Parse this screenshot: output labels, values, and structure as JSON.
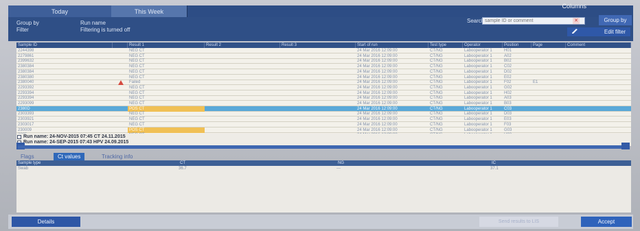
{
  "top": {
    "tabs": [
      "Today",
      "This Week"
    ],
    "right_label": "Columns"
  },
  "filters": {
    "group_by_label": "Group by",
    "run_name_label": "Run name",
    "filter_label": "Filter",
    "filter_value": "Filtering is turned off",
    "search_label": "Search",
    "search_placeholder": "sample ID or comment",
    "group_by_button": "Group by",
    "edit_filter_button": "Edit filter"
  },
  "table": {
    "columns": [
      "Sample ID",
      "",
      "Result 1",
      "Result 2",
      "Result 3",
      "Start of run",
      "Test type",
      "Operator",
      "Position",
      "Page",
      "Comment"
    ],
    "rows": [
      {
        "sample_id": "2244398",
        "result1": "NEG CT",
        "start": "24 Mar 2016 12:09:00",
        "test": "CT/NG",
        "operator": "Labooperator 1",
        "position": "H01",
        "page": "",
        "comment": ""
      },
      {
        "sample_id": "2279861",
        "result1": "NEG CT",
        "start": "24 Mar 2016 12:09:00",
        "test": "CT/NG",
        "operator": "Labooperator 1",
        "position": "A02",
        "page": "",
        "comment": ""
      },
      {
        "sample_id": "2399632",
        "result1": "NEG CT",
        "start": "24 Mar 2016 12:09:00",
        "test": "CT/NG",
        "operator": "Labooperator 1",
        "position": "B02",
        "page": "",
        "comment": ""
      },
      {
        "sample_id": "2380384",
        "result1": "NEG CT",
        "start": "24 Mar 2016 12:09:00",
        "test": "CT/NG",
        "operator": "Labooperator 1",
        "position": "C02",
        "page": "",
        "comment": ""
      },
      {
        "sample_id": "2380384",
        "result1": "NEG CT",
        "start": "24 Mar 2016 12:09:00",
        "test": "CT/NG",
        "operator": "Labooperator 1",
        "position": "D02",
        "page": "",
        "comment": ""
      },
      {
        "sample_id": "2380380",
        "result1": "NEG CT",
        "start": "24 Mar 2016 12:09:00",
        "test": "CT/NG",
        "operator": "Labooperator 1",
        "position": "E02",
        "page": "",
        "comment": ""
      },
      {
        "sample_id": "2380040",
        "result1": "Failed",
        "start": "24 Mar 2016 12:09:00",
        "test": "CT/NG",
        "operator": "Labooperator 1",
        "position": "F02",
        "page": "E1",
        "comment": "",
        "warning": true
      },
      {
        "sample_id": "2293392",
        "result1": "NEG CT",
        "start": "24 Mar 2016 12:09:00",
        "test": "CT/NG",
        "operator": "Labooperator 1",
        "position": "G02",
        "page": "",
        "comment": ""
      },
      {
        "sample_id": "2293394",
        "result1": "NEG CT",
        "start": "24 Mar 2016 12:09:00",
        "test": "CT/NG",
        "operator": "Labooperator 1",
        "position": "H02",
        "page": "",
        "comment": ""
      },
      {
        "sample_id": "2293394",
        "result1": "NEG CT",
        "start": "24 Mar 2016 12:09:00",
        "test": "CT/NG",
        "operator": "Labooperator 1",
        "position": "A03",
        "page": "",
        "comment": ""
      },
      {
        "sample_id": "2293099",
        "result1": "NEG CT",
        "start": "24 Mar 2016 12:09:00",
        "test": "CT/NG",
        "operator": "Labooperator 1",
        "position": "B03",
        "page": "",
        "comment": ""
      },
      {
        "sample_id": "2380D",
        "result1": "POS CT",
        "start": "24 Mar 2016 12:09:00",
        "test": "CT/NG",
        "operator": "Labooperator 1",
        "position": "C03",
        "page": "",
        "comment": "",
        "selected": true,
        "highlight": true
      },
      {
        "sample_id": "2303393",
        "result1": "NEG CT",
        "start": "24 Mar 2016 12:09:00",
        "test": "CT/NG",
        "operator": "Labooperator 1",
        "position": "D03",
        "page": "",
        "comment": ""
      },
      {
        "sample_id": "2303921",
        "result1": "NEG CT",
        "start": "24 Mar 2016 12:09:00",
        "test": "CT/NG",
        "operator": "Labooperator 1",
        "position": "E03",
        "page": "",
        "comment": ""
      },
      {
        "sample_id": "2303017",
        "result1": "NEG CT",
        "start": "24 Mar 2016 12:09:00",
        "test": "CT/NG",
        "operator": "Labooperator 1",
        "position": "F03",
        "page": "",
        "comment": ""
      },
      {
        "sample_id": "230009",
        "result1": "POS CT",
        "start": "24 Mar 2016 12:09:00",
        "test": "CT/NG",
        "operator": "Labooperator 1",
        "position": "G03",
        "page": "",
        "comment": "",
        "highlight": true
      },
      {
        "sample_id": "2305",
        "result1": "NEG CT",
        "start": "24 Mar 2016 12:09:00",
        "test": "CT/NG",
        "operator": "Labooperator 1",
        "position": "H03",
        "page": "",
        "comment": ""
      }
    ]
  },
  "runs": [
    "Run name: 24-NOV-2015 07:45 CT 24.11.2015",
    "Run name: 24-SEP-2015 07:43 HPV 24.09.2015"
  ],
  "subtabs": [
    "Flags",
    "Ct values",
    "Tracking info"
  ],
  "detail": {
    "columns": [
      "Sample type",
      "CT",
      "NG",
      "IC"
    ],
    "row": {
      "sample_type": "Swab",
      "ct": "36.7",
      "ng": "---",
      "ic": "37.1"
    }
  },
  "footer": {
    "details": "Details",
    "disabled": "Send results to LIS",
    "accept": "Accept"
  }
}
